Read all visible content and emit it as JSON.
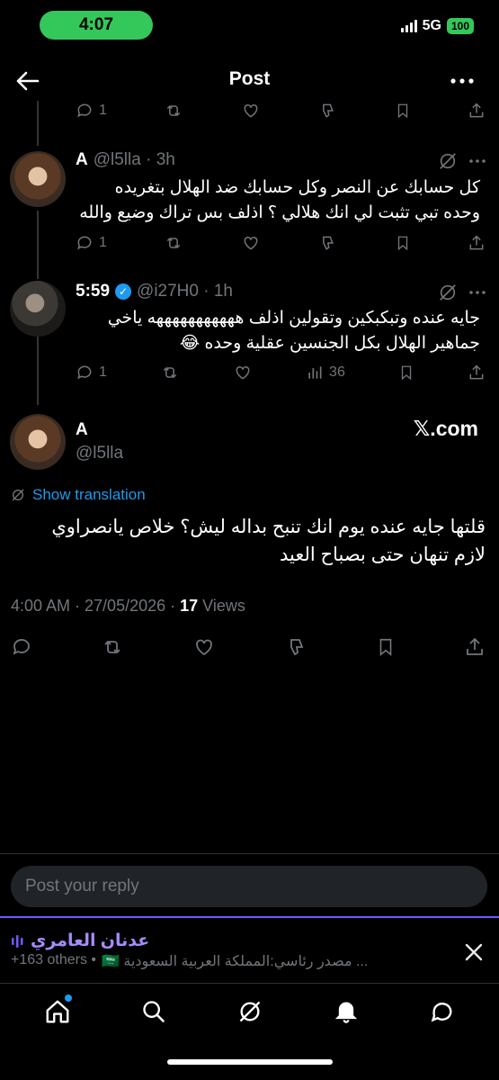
{
  "status_bar": {
    "time": "4:07",
    "network": "5G",
    "battery": "100"
  },
  "header": {
    "title": "Post"
  },
  "top_actions": {
    "replies": "1"
  },
  "reply1": {
    "name": "A",
    "meta": "@l5lla · 3h",
    "text_line1": "كل حسابك عن النصر وكل حسابك ضد الهلال بتغريده",
    "text_line2": "وحده تبي تثبت لي انك هلالي ؟ اذلف بس تراك وضيع والله",
    "replies": "1"
  },
  "reply2": {
    "name": "5:59",
    "meta": "@i27H0 · 1h",
    "text_line1": "جايه عنده وتبكبكين وتقولين اذلف هههههههههههه ياخي",
    "text_line2": "جماهير الهلال بكل الجنسين عقلية وحده 😂",
    "replies": "1",
    "views": "36"
  },
  "main_post": {
    "name": "A",
    "handle": "@l5lla",
    "watermark": "𝕏.com",
    "translation": "Show translation",
    "text_line1": "قلتها جايه عنده يوم انك تنبح بداله ليش؟ خلاص يانصراوي",
    "text_line2": "لازم تنهان حتى بصباح العيد",
    "timestamp": "4:00 AM · 27/05/2026 · ",
    "views_count": "17",
    "views_label": " Views"
  },
  "reply_input": {
    "placeholder": "Post your reply"
  },
  "spaces": {
    "host": "عدنان العامري",
    "others": "+163 others •",
    "description": "... مصدر رئاسي:المملكة العربية السعودية 🇸🇦"
  },
  "colors": {
    "accent": "#1d9bf0",
    "spaces": "#7856ff",
    "status_green": "#34c759"
  }
}
